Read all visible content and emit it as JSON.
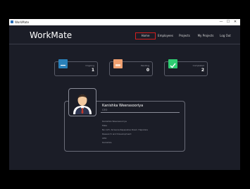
{
  "window": {
    "title": "WorkMate",
    "minimize": "—",
    "maximize": "☐",
    "close": "✕"
  },
  "header": {
    "logo": "WorkMate",
    "nav": [
      "Home",
      "Employees",
      "Projects",
      "My Projects",
      "Log Out"
    ],
    "active_nav": "Home"
  },
  "stats": [
    {
      "label": "Ongoing",
      "value": "1",
      "color": "#2980b9"
    },
    {
      "label": "Pending",
      "value": "0",
      "color": "#f0a070"
    },
    {
      "label": "Completed",
      "value": "2",
      "color": "#2ecc71"
    }
  ],
  "profile": {
    "name": "Kanishka Weerasooriya",
    "role": "CEO",
    "details": [
      "Kanishka Weerasooriya",
      "Male",
      "No.123, Sirisena Rajapaksa Road, Haputale",
      "Research and Development",
      "CEO",
      "Kanishka"
    ]
  }
}
